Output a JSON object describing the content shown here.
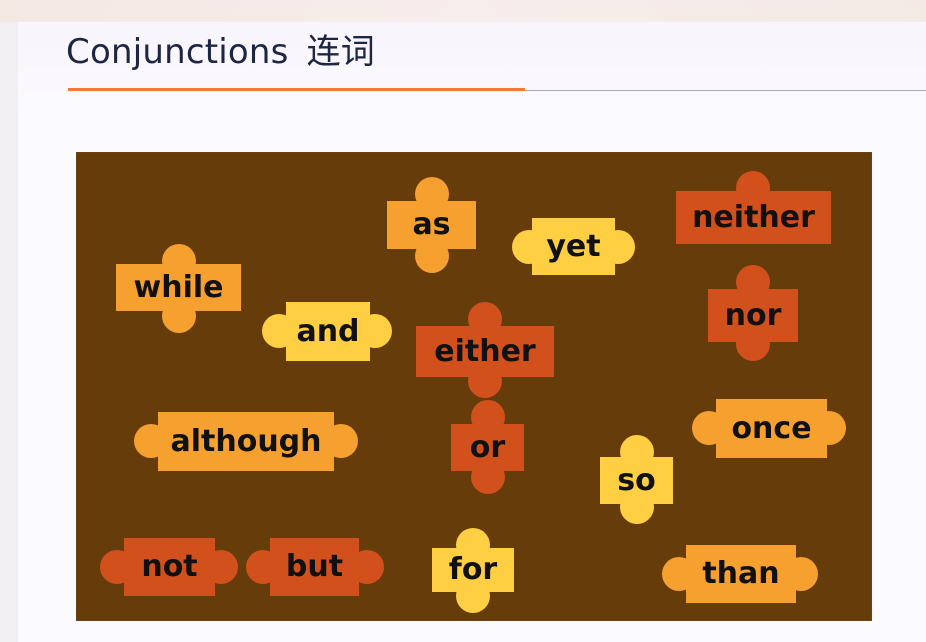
{
  "slide": {
    "title": "Conjunctions",
    "title_cn": "连词"
  },
  "puzzle_board": {
    "words": [
      {
        "label": "as",
        "color": "#f6a02f"
      },
      {
        "label": "yet",
        "color": "#ffcf43"
      },
      {
        "label": "neither",
        "color": "#d2501c"
      },
      {
        "label": "while",
        "color": "#f6a02f"
      },
      {
        "label": "and",
        "color": "#ffcf43"
      },
      {
        "label": "either",
        "color": "#d2501c"
      },
      {
        "label": "nor",
        "color": "#d2501c"
      },
      {
        "label": "although",
        "color": "#f6a02f"
      },
      {
        "label": "or",
        "color": "#d2501c"
      },
      {
        "label": "once",
        "color": "#f6a02f"
      },
      {
        "label": "so",
        "color": "#ffcf43"
      },
      {
        "label": "not",
        "color": "#d2501c"
      },
      {
        "label": "but",
        "color": "#d2501c"
      },
      {
        "label": "for",
        "color": "#ffcf43"
      },
      {
        "label": "than",
        "color": "#f6a02f"
      }
    ]
  }
}
